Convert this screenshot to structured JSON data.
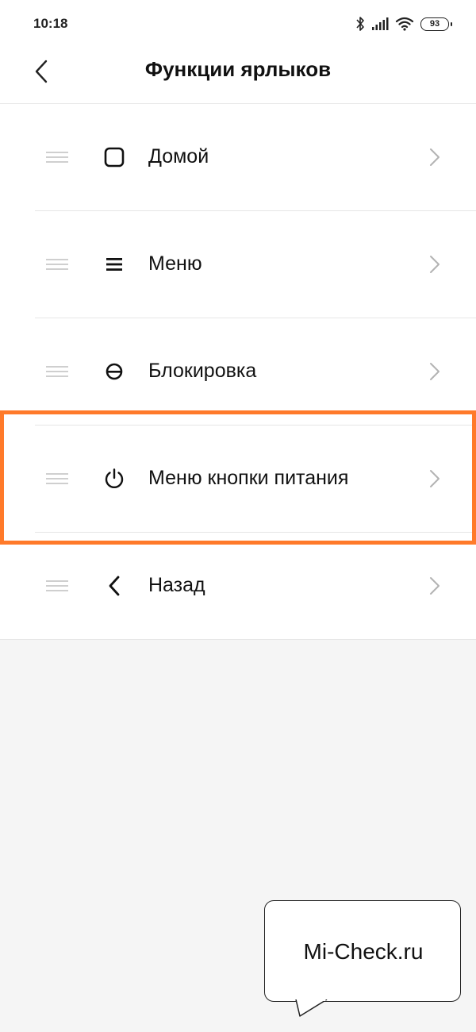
{
  "status_bar": {
    "time": "10:18",
    "battery": "93",
    "icons": [
      "bluetooth-icon",
      "signal-icon",
      "wifi-icon",
      "battery-icon"
    ]
  },
  "header": {
    "title": "Функции ярлыков",
    "back_icon": "chevron-left-icon"
  },
  "items": [
    {
      "label": "Домой",
      "icon": "home-square-icon"
    },
    {
      "label": "Меню",
      "icon": "menu-icon"
    },
    {
      "label": "Блокировка",
      "icon": "lock-icon"
    },
    {
      "label": "Меню кнопки питания",
      "icon": "power-icon",
      "highlighted": true
    },
    {
      "label": "Назад",
      "icon": "back-icon"
    }
  ],
  "watermark": {
    "text": "Mi-Check.ru"
  },
  "colors": {
    "highlight": "#ff7a2a",
    "background": "#f5f5f5"
  }
}
